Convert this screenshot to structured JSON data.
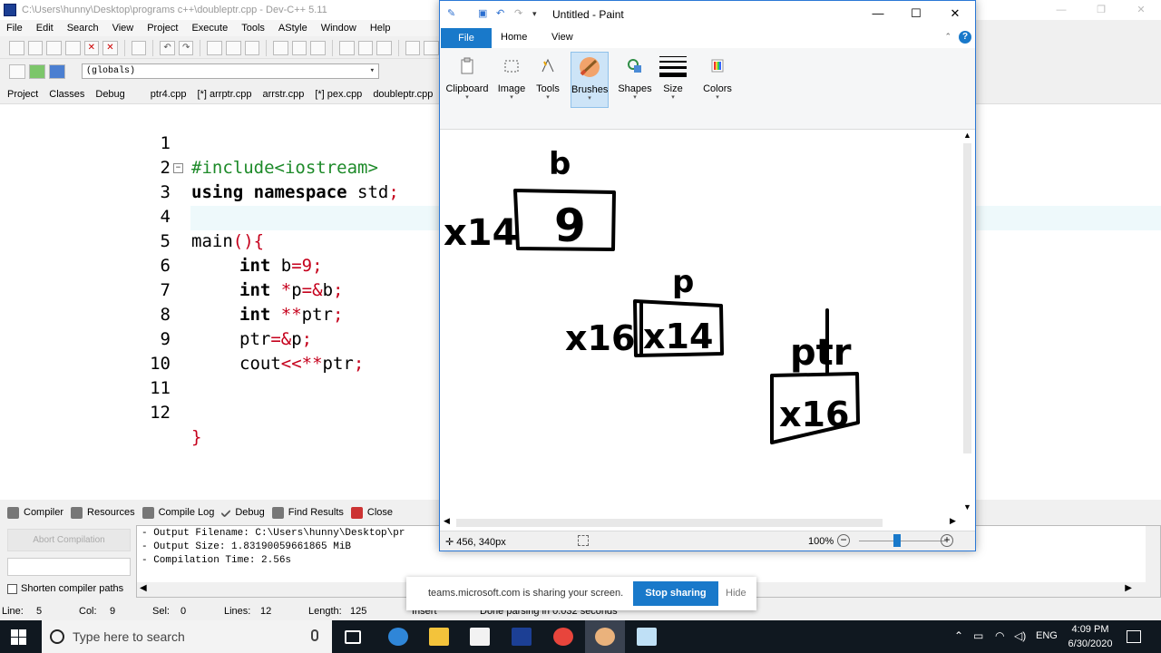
{
  "devcpp": {
    "title": "C:\\Users\\hunny\\Desktop\\programs c++\\doubleptr.cpp - Dev-C++ 5.11",
    "menu": [
      "File",
      "Edit",
      "Search",
      "View",
      "Project",
      "Execute",
      "Tools",
      "AStyle",
      "Window",
      "Help"
    ],
    "scope_select": "(globals)",
    "panel_tabs": [
      "Project",
      "Classes",
      "Debug"
    ],
    "file_tabs": [
      "ptr4.cpp",
      "[*] arrptr.cpp",
      "arrstr.cpp",
      "[*] pex.cpp",
      "doubleptr.cpp"
    ],
    "line_numbers": [
      "1",
      "2",
      "3",
      "4",
      "5",
      "6",
      "7",
      "8",
      "9",
      "10",
      "11",
      "12"
    ],
    "code": {
      "l1_pp": "#include<iostream>",
      "l2_kw": "using namespace",
      "l2_rest": " std",
      "l2_sym": ";",
      "l3_a": "main",
      "l3_sym": "(){",
      "l5_kw": "int",
      "l5_a": " b",
      "l5_sym": "=9;",
      "l6_kw": "int",
      "l6_sym1": " *",
      "l6_a": "p",
      "l6_sym2": "=&",
      "l6_b": "b",
      "l6_sym3": ";",
      "l7_kw": "int",
      "l7_sym1": " **",
      "l7_a": "ptr",
      "l7_sym2": ";",
      "l8_a": "ptr",
      "l8_sym1": "=&",
      "l8_b": "p",
      "l8_sym2": ";",
      "l9_a": "cout",
      "l9_sym1": "<<**",
      "l9_b": "ptr",
      "l9_sym2": ";",
      "l12_sym": "}"
    },
    "bottom_tabs": [
      "Compiler",
      "Resources",
      "Compile Log",
      "Debug",
      "Find Results",
      "Close"
    ],
    "abort_label": "Abort Compilation",
    "shorten_label": "Shorten compiler paths",
    "log": [
      "- Output Filename: C:\\Users\\hunny\\Desktop\\pr",
      "- Output Size: 1.83190059661865 MiB",
      "- Compilation Time: 2.56s"
    ],
    "status": {
      "line_label": "Line:",
      "line_val": "5",
      "col_label": "Col:",
      "col_val": "9",
      "sel_label": "Sel:",
      "sel_val": "0",
      "lines_label": "Lines:",
      "lines_val": "12",
      "length_label": "Length:",
      "length_val": "125",
      "insert": "Insert",
      "parse": "Done parsing in 0.032 seconds"
    }
  },
  "paint": {
    "title": "Untitled - Paint",
    "tabs": {
      "file": "File",
      "home": "Home",
      "view": "View"
    },
    "ribbon": [
      "Clipboard",
      "Image",
      "Tools",
      "Brushes",
      "Shapes",
      "Size",
      "Colors"
    ],
    "drawing_labels": [
      "b",
      "9",
      "x14",
      "p",
      "x14",
      "x16",
      "ptr",
      "x16"
    ],
    "coords": "456, 340px",
    "zoom": "100%"
  },
  "share": {
    "message": "teams.microsoft.com is sharing your screen.",
    "stop": "Stop sharing",
    "hide": "Hide"
  },
  "taskbar": {
    "search_placeholder": "Type here to search",
    "lang": "ENG",
    "time": "4:09 PM",
    "date": "6/30/2020"
  }
}
